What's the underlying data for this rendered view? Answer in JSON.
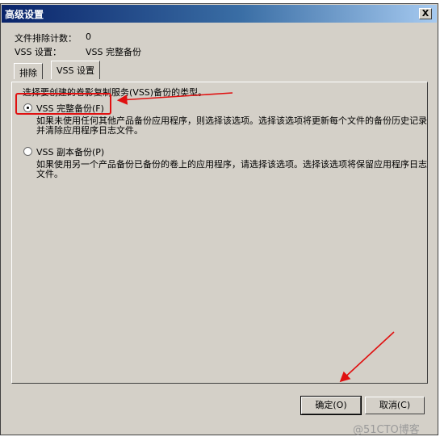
{
  "window": {
    "title": "高级设置",
    "close_label": "X"
  },
  "info": {
    "exclude_count_label": "文件排除计数：",
    "exclude_count_value": "0",
    "vss_setting_label": "VSS 设置：",
    "vss_setting_value": "VSS 完整备份"
  },
  "tabs": [
    {
      "label": "排除"
    },
    {
      "label": "VSS 设置"
    }
  ],
  "panel": {
    "instruction": "选择要创建的卷影复制服务(VSS)备份的类型。",
    "options": [
      {
        "label": "VSS 完整备份(F)",
        "selected": true,
        "description": "如果未使用任何其他产品备份应用程序，则选择该选项。选择该选项将更新每个文件的备份历史记录并清除应用程序日志文件。"
      },
      {
        "label": "VSS 副本备份(P)",
        "selected": false,
        "description": "如果使用另一个产品备份已备份的卷上的应用程序，请选择该选项。选择该选项将保留应用程序日志文件。"
      }
    ]
  },
  "buttons": {
    "ok_label": "确定(O)",
    "cancel_label": "取消(C)"
  },
  "annotation": {
    "color": "#e01010"
  },
  "watermark": "@51CTO博客"
}
